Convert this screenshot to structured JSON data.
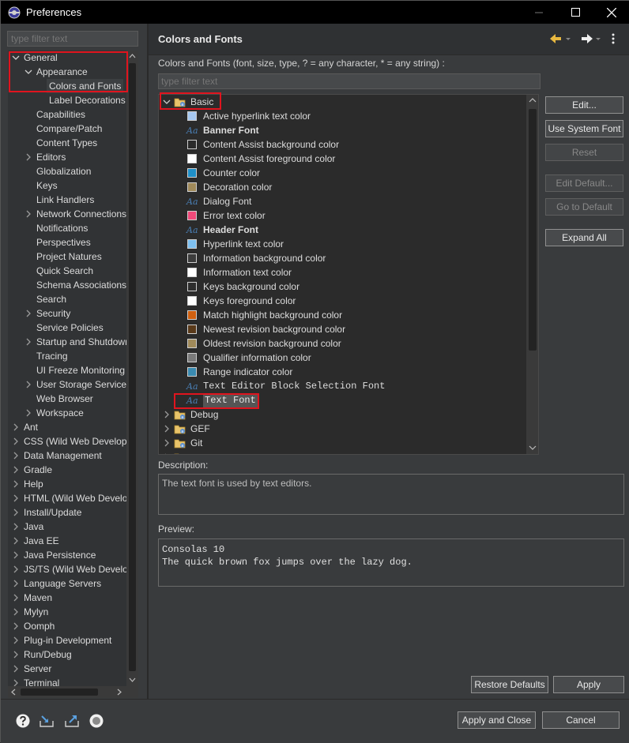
{
  "window": {
    "title": "Preferences"
  },
  "left": {
    "filter_placeholder": "type filter text",
    "tree": [
      {
        "label": "General",
        "level": 0,
        "expanded": true
      },
      {
        "label": "Appearance",
        "level": 1,
        "expanded": true
      },
      {
        "label": "Colors and Fonts",
        "level": 2,
        "selected": true
      },
      {
        "label": "Label Decorations",
        "level": 2
      },
      {
        "label": "Capabilities",
        "level": 1
      },
      {
        "label": "Compare/Patch",
        "level": 1
      },
      {
        "label": "Content Types",
        "level": 1
      },
      {
        "label": "Editors",
        "level": 1,
        "collapsed": true
      },
      {
        "label": "Globalization",
        "level": 1
      },
      {
        "label": "Keys",
        "level": 1
      },
      {
        "label": "Link Handlers",
        "level": 1
      },
      {
        "label": "Network Connections",
        "level": 1,
        "collapsed": true
      },
      {
        "label": "Notifications",
        "level": 1
      },
      {
        "label": "Perspectives",
        "level": 1
      },
      {
        "label": "Project Natures",
        "level": 1
      },
      {
        "label": "Quick Search",
        "level": 1
      },
      {
        "label": "Schema Associations",
        "level": 1
      },
      {
        "label": "Search",
        "level": 1
      },
      {
        "label": "Security",
        "level": 1,
        "collapsed": true
      },
      {
        "label": "Service Policies",
        "level": 1
      },
      {
        "label": "Startup and Shutdown",
        "level": 1,
        "collapsed": true
      },
      {
        "label": "Tracing",
        "level": 1
      },
      {
        "label": "UI Freeze Monitoring",
        "level": 1
      },
      {
        "label": "User Storage Service",
        "level": 1,
        "collapsed": true
      },
      {
        "label": "Web Browser",
        "level": 1
      },
      {
        "label": "Workspace",
        "level": 1,
        "collapsed": true
      },
      {
        "label": "Ant",
        "level": 0,
        "collapsed": true
      },
      {
        "label": "CSS (Wild Web Developer)",
        "level": 0,
        "collapsed": true
      },
      {
        "label": "Data Management",
        "level": 0,
        "collapsed": true
      },
      {
        "label": "Gradle",
        "level": 0,
        "collapsed": true
      },
      {
        "label": "Help",
        "level": 0,
        "collapsed": true
      },
      {
        "label": "HTML (Wild Web Developer)",
        "level": 0,
        "collapsed": true
      },
      {
        "label": "Install/Update",
        "level": 0,
        "collapsed": true
      },
      {
        "label": "Java",
        "level": 0,
        "collapsed": true
      },
      {
        "label": "Java EE",
        "level": 0,
        "collapsed": true
      },
      {
        "label": "Java Persistence",
        "level": 0,
        "collapsed": true
      },
      {
        "label": "JS/TS (Wild Web Developer)",
        "level": 0,
        "collapsed": true
      },
      {
        "label": "Language Servers",
        "level": 0,
        "collapsed": true
      },
      {
        "label": "Maven",
        "level": 0,
        "collapsed": true
      },
      {
        "label": "Mylyn",
        "level": 0,
        "collapsed": true
      },
      {
        "label": "Oomph",
        "level": 0,
        "collapsed": true
      },
      {
        "label": "Plug-in Development",
        "level": 0,
        "collapsed": true
      },
      {
        "label": "Run/Debug",
        "level": 0,
        "collapsed": true
      },
      {
        "label": "Server",
        "level": 0,
        "collapsed": true
      },
      {
        "label": "Terminal",
        "level": 0,
        "collapsed": true
      }
    ]
  },
  "right": {
    "header": "Colors and Fonts",
    "description_label": "Colors and Fonts (font, size, type, ? = any character, * = any string) :",
    "filter_placeholder": "type filter text",
    "category_basic": "Basic",
    "entries": [
      {
        "label": "Active hyperlink text color",
        "kind": "color",
        "color": "#a6c8f0"
      },
      {
        "label": "Banner Font",
        "kind": "font",
        "bold": true
      },
      {
        "label": "Content Assist background color",
        "kind": "color",
        "color": "#2b2b2b"
      },
      {
        "label": "Content Assist foreground color",
        "kind": "color",
        "color": "#ffffff"
      },
      {
        "label": "Counter color",
        "kind": "color",
        "color": "#1f8fc8"
      },
      {
        "label": "Decoration color",
        "kind": "color",
        "color": "#a08a5a"
      },
      {
        "label": "Dialog Font",
        "kind": "font"
      },
      {
        "label": "Error text color",
        "kind": "color",
        "color": "#f04a7a"
      },
      {
        "label": "Header Font",
        "kind": "font",
        "bold": true
      },
      {
        "label": "Hyperlink text color",
        "kind": "color",
        "color": "#7ec0f0"
      },
      {
        "label": "Information background color",
        "kind": "color",
        "color": "#3c3c3c"
      },
      {
        "label": "Information text color",
        "kind": "color",
        "color": "#ffffff"
      },
      {
        "label": "Keys background color",
        "kind": "color",
        "color": "#2e2e2e"
      },
      {
        "label": "Keys foreground color",
        "kind": "color",
        "color": "#ffffff"
      },
      {
        "label": "Match highlight background color",
        "kind": "color",
        "color": "#d06010"
      },
      {
        "label": "Newest revision background color",
        "kind": "color",
        "color": "#5a3a1a"
      },
      {
        "label": "Oldest revision background color",
        "kind": "color",
        "color": "#a08a5a"
      },
      {
        "label": "Qualifier information color",
        "kind": "color",
        "color": "#7a7a7a"
      },
      {
        "label": "Range indicator color",
        "kind": "color",
        "color": "#3a8ab0"
      },
      {
        "label": "Text Editor Block Selection Font",
        "kind": "font",
        "mono": true
      },
      {
        "label": "Text Font",
        "kind": "font",
        "mono": true,
        "selected": true
      }
    ],
    "categories_after": [
      "Debug",
      "GEF",
      "Git"
    ],
    "buttons": {
      "edit": "Edit...",
      "use_system_font": "Use System Font",
      "reset": "Reset",
      "edit_default": "Edit Default...",
      "go_to_default": "Go to Default",
      "expand_all": "Expand All"
    },
    "description_title": "Description:",
    "description_text": "The text font is used by text editors.",
    "preview_title": "Preview:",
    "preview_lines": [
      "Consolas 10",
      "The quick brown fox jumps over the lazy dog."
    ],
    "restore_defaults": "Restore Defaults",
    "apply": "Apply"
  },
  "footer": {
    "apply_and_close": "Apply and Close",
    "cancel": "Cancel",
    "icons": [
      "help-icon",
      "import-icon",
      "export-icon",
      "record-icon"
    ]
  }
}
